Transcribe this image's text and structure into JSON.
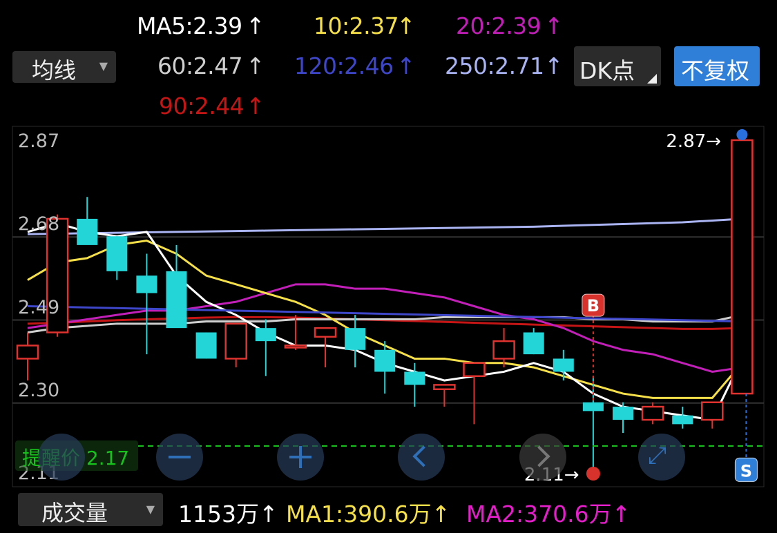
{
  "ma_header": {
    "ma5": "MA5:2.39",
    "ma10": "10:2.37",
    "ma20": "20:2.39",
    "ma60": "60:2.47",
    "ma120": "120:2.46",
    "ma250": "250:2.71",
    "ma90": "90:2.44",
    "arrow": "↑"
  },
  "controls": {
    "ma_select": "均线",
    "dk_button": "DK点",
    "adjust_button": "不复权"
  },
  "colors": {
    "up": "#e0332f",
    "down": "#24d5d8",
    "ma5": "#ffffff",
    "ma10": "#f5e04a",
    "ma20": "#c21fb9",
    "ma60": "#cfcfcf",
    "ma120": "#3e46c9",
    "ma250": "#aab4f2",
    "ma90": "#c51515",
    "alert": "#16c21b"
  },
  "chart_data": {
    "type": "candlestick",
    "y_ticks": [
      "2.87",
      "2.68",
      "2.49",
      "2.30",
      "2.11"
    ],
    "ylim": [
      2.11,
      2.87
    ],
    "candles": [
      {
        "o": 2.37,
        "h": 2.43,
        "l": 2.32,
        "c": 2.4
      },
      {
        "o": 2.43,
        "h": 2.7,
        "l": 2.42,
        "c": 2.69
      },
      {
        "o": 2.69,
        "h": 2.74,
        "l": 2.64,
        "c": 2.63
      },
      {
        "o": 2.65,
        "h": 2.65,
        "l": 2.55,
        "c": 2.57
      },
      {
        "o": 2.56,
        "h": 2.61,
        "l": 2.38,
        "c": 2.52
      },
      {
        "o": 2.57,
        "h": 2.63,
        "l": 2.46,
        "c": 2.44
      },
      {
        "o": 2.43,
        "h": 2.43,
        "l": 2.37,
        "c": 2.37
      },
      {
        "o": 2.37,
        "h": 2.45,
        "l": 2.35,
        "c": 2.45
      },
      {
        "o": 2.44,
        "h": 2.46,
        "l": 2.33,
        "c": 2.41
      },
      {
        "o": 2.4,
        "h": 2.47,
        "l": 2.39,
        "c": 2.4
      },
      {
        "o": 2.42,
        "h": 2.44,
        "l": 2.35,
        "c": 2.44
      },
      {
        "o": 2.44,
        "h": 2.47,
        "l": 2.35,
        "c": 2.39
      },
      {
        "o": 2.39,
        "h": 2.41,
        "l": 2.29,
        "c": 2.34
      },
      {
        "o": 2.34,
        "h": 2.36,
        "l": 2.26,
        "c": 2.31
      },
      {
        "o": 2.3,
        "h": 2.31,
        "l": 2.26,
        "c": 2.31
      },
      {
        "o": 2.33,
        "h": 2.36,
        "l": 2.22,
        "c": 2.36
      },
      {
        "o": 2.37,
        "h": 2.44,
        "l": 2.35,
        "c": 2.41
      },
      {
        "o": 2.43,
        "h": 2.44,
        "l": 2.38,
        "c": 2.38
      },
      {
        "o": 2.37,
        "h": 2.39,
        "l": 2.32,
        "c": 2.34
      },
      {
        "o": 2.27,
        "h": 2.33,
        "l": 2.1,
        "c": 2.25
      },
      {
        "o": 2.26,
        "h": 2.27,
        "l": 2.2,
        "c": 2.23
      },
      {
        "o": 2.23,
        "h": 2.27,
        "l": 2.22,
        "c": 2.26
      },
      {
        "o": 2.24,
        "h": 2.26,
        "l": 2.21,
        "c": 2.22
      },
      {
        "o": 2.23,
        "h": 2.27,
        "l": 2.21,
        "c": 2.27
      },
      {
        "o": 2.29,
        "h": 2.87,
        "l": 2.29,
        "c": 2.87
      }
    ],
    "ma_lines": {
      "ma5": [
        2.66,
        2.68,
        2.66,
        2.65,
        2.66,
        2.56,
        2.5,
        2.47,
        2.43,
        2.4,
        2.4,
        2.39,
        2.36,
        2.34,
        2.32,
        2.33,
        2.34,
        2.36,
        2.34,
        2.29,
        2.26,
        2.25,
        2.24,
        2.23,
        2.37
      ],
      "ma10": [
        2.55,
        2.59,
        2.6,
        2.63,
        2.64,
        2.61,
        2.56,
        2.54,
        2.52,
        2.5,
        2.47,
        2.43,
        2.4,
        2.37,
        2.37,
        2.36,
        2.36,
        2.35,
        2.33,
        2.31,
        2.29,
        2.28,
        2.28,
        2.28,
        2.36
      ],
      "ma20": [
        2.44,
        2.45,
        2.46,
        2.47,
        2.48,
        2.48,
        2.49,
        2.5,
        2.52,
        2.54,
        2.54,
        2.53,
        2.53,
        2.52,
        2.51,
        2.49,
        2.47,
        2.46,
        2.44,
        2.41,
        2.39,
        2.38,
        2.36,
        2.34,
        2.35
      ],
      "ma60": [
        2.43,
        2.44,
        2.445,
        2.45,
        2.45,
        2.45,
        2.455,
        2.455,
        2.455,
        2.46,
        2.46,
        2.46,
        2.46,
        2.46,
        2.465,
        2.465,
        2.465,
        2.465,
        2.465,
        2.46,
        2.46,
        2.455,
        2.455,
        2.455,
        2.47
      ],
      "ma90": [
        2.45,
        2.452,
        2.455,
        2.458,
        2.46,
        2.462,
        2.464,
        2.465,
        2.465,
        2.464,
        2.462,
        2.46,
        2.458,
        2.456,
        2.454,
        2.452,
        2.45,
        2.448,
        2.446,
        2.444,
        2.442,
        2.44,
        2.438,
        2.438,
        2.44
      ],
      "ma250": [
        2.655,
        2.656,
        2.657,
        2.658,
        2.659,
        2.66,
        2.661,
        2.662,
        2.663,
        2.664,
        2.665,
        2.666,
        2.667,
        2.668,
        2.669,
        2.67,
        2.671,
        2.672,
        2.674,
        2.676,
        2.678,
        2.68,
        2.682,
        2.686,
        2.69
      ]
    },
    "ma120_endpoints": [
      2.49,
      2.455
    ],
    "high_label": "2.87→",
    "low_label": "2.11→",
    "buy_marker": "B",
    "sell_marker": "S",
    "alert_price": 2.17,
    "alert_label": "提醒价 2.17"
  },
  "volume": {
    "select": "成交量",
    "value": "1153万↑",
    "ma1": "MA1:390.6万↑",
    "ma2": "MA2:370.6万↑"
  }
}
